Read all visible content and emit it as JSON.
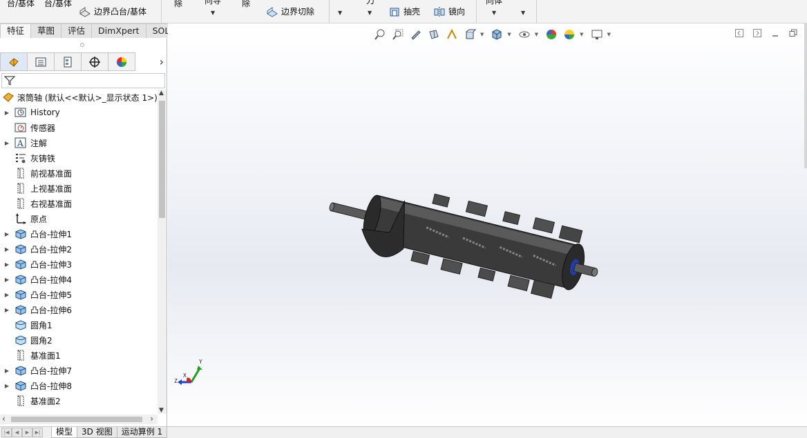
{
  "ribbon": {
    "item1": "台/基体",
    "item2": "台/基体",
    "boundary_boss": "边界凸台/基体",
    "cut1": "除",
    "cut2": "除",
    "wrap": "向导",
    "boundary_cut": "边界切除",
    "shell": "抽壳",
    "mirror": "镜向",
    "partial1": "刀",
    "partial2": "向体"
  },
  "command_tabs": [
    "特征",
    "草图",
    "评估",
    "DimXpert",
    "SOLIDWORKS 插件"
  ],
  "tree": {
    "root": "滚筒轴 (默认<<默认>_显示状态 1>)",
    "items": [
      {
        "label": "History",
        "icon": "history-icon",
        "expand": true
      },
      {
        "label": "传感器",
        "icon": "sensor-icon",
        "expand": false
      },
      {
        "label": "注解",
        "icon": "annotation-icon",
        "expand": true
      },
      {
        "label": "灰铸铁",
        "icon": "material-icon",
        "expand": false
      },
      {
        "label": "前视基准面",
        "icon": "plane-icon",
        "expand": false
      },
      {
        "label": "上视基准面",
        "icon": "plane-icon",
        "expand": false
      },
      {
        "label": "右视基准面",
        "icon": "plane-icon",
        "expand": false
      },
      {
        "label": "原点",
        "icon": "origin-icon",
        "expand": false
      },
      {
        "label": "凸台-拉伸1",
        "icon": "extrude-icon",
        "expand": true
      },
      {
        "label": "凸台-拉伸2",
        "icon": "extrude-icon",
        "expand": true
      },
      {
        "label": "凸台-拉伸3",
        "icon": "extrude-icon",
        "expand": true
      },
      {
        "label": "凸台-拉伸4",
        "icon": "extrude-icon",
        "expand": true
      },
      {
        "label": "凸台-拉伸5",
        "icon": "extrude-icon",
        "expand": true
      },
      {
        "label": "凸台-拉伸6",
        "icon": "extrude-icon",
        "expand": true
      },
      {
        "label": "圆角1",
        "icon": "fillet-icon",
        "expand": false
      },
      {
        "label": "圆角2",
        "icon": "fillet-icon",
        "expand": false
      },
      {
        "label": "基准面1",
        "icon": "plane-icon",
        "expand": false
      },
      {
        "label": "凸台-拉伸7",
        "icon": "extrude-icon",
        "expand": true
      },
      {
        "label": "凸台-拉伸8",
        "icon": "extrude-icon",
        "expand": true
      },
      {
        "label": "基准面2",
        "icon": "plane-icon",
        "expand": false
      }
    ]
  },
  "triad": {
    "x": "X",
    "y": "Y",
    "z": "Z"
  },
  "bottom_tabs": [
    "模型",
    "3D 视图",
    "运动算例 1"
  ],
  "colors": {
    "accent": "#dfe9f5",
    "model": "#3a3a3a",
    "triad_x": "#d02020",
    "triad_y": "#20a020",
    "triad_z": "#2040d0"
  }
}
